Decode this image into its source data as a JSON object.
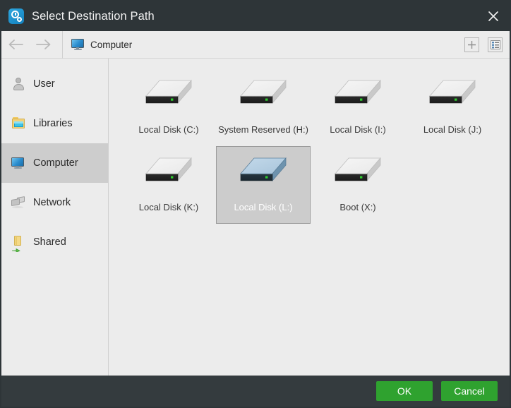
{
  "window": {
    "title": "Select Destination Path",
    "app_icon": "gear-clock-icon",
    "close_icon": "close-icon",
    "titlebar_color": "#2e3538"
  },
  "toolbar": {
    "back_icon": "arrow-left-icon",
    "forward_icon": "arrow-right-icon",
    "breadcrumb": {
      "icon": "computer-monitor-icon",
      "label": "Computer"
    },
    "new_folder_icon": "plus-icon",
    "view_list_icon": "list-view-icon"
  },
  "sidebar": {
    "active_index": 2,
    "items": [
      {
        "label": "User",
        "icon": "user-icon"
      },
      {
        "label": "Libraries",
        "icon": "libraries-folder-icon"
      },
      {
        "label": "Computer",
        "icon": "computer-monitor-icon"
      },
      {
        "label": "Network",
        "icon": "network-icon"
      },
      {
        "label": "Shared",
        "icon": "shared-folder-icon"
      }
    ]
  },
  "content": {
    "selected_index": 5,
    "drives": [
      {
        "label": "Local Disk (C:)",
        "icon": "hard-drive-icon",
        "selected": false
      },
      {
        "label": "System Reserved (H:)",
        "icon": "hard-drive-icon",
        "selected": false
      },
      {
        "label": "Local Disk (I:)",
        "icon": "hard-drive-icon",
        "selected": false
      },
      {
        "label": "Local Disk (J:)",
        "icon": "hard-drive-icon",
        "selected": false
      },
      {
        "label": "Local Disk (K:)",
        "icon": "hard-drive-icon",
        "selected": false
      },
      {
        "label": "Local Disk (L:)",
        "icon": "hard-drive-icon",
        "selected": true
      },
      {
        "label": "Boot (X:)",
        "icon": "hard-drive-icon",
        "selected": false
      }
    ]
  },
  "footer": {
    "ok_label": "OK",
    "cancel_label": "Cancel",
    "button_color": "#2fa22f",
    "background_color": "#343b3e"
  }
}
